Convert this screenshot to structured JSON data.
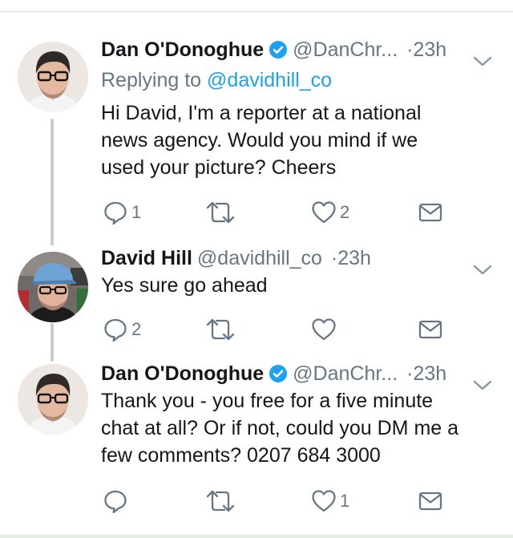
{
  "tweets": [
    {
      "author_name": "Dan O'Donoghue",
      "handle": "@DanChr...",
      "separator": "·",
      "time": "23h",
      "replying_prefix": "Replying to",
      "replying_to": "@davidhill_co",
      "text_lines": [
        "Hi David, I'm a reporter at a national",
        "news agency. Would you mind if we",
        "used your picture? Cheers"
      ],
      "replies": "1",
      "retweets": "",
      "likes": "2"
    },
    {
      "author_name": "David Hill",
      "handle": "@davidhill_co",
      "separator": "·",
      "time": "23h",
      "text_lines": [
        "Yes sure go ahead"
      ],
      "replies": "2",
      "retweets": "",
      "likes": ""
    },
    {
      "author_name": "Dan O'Donoghue",
      "handle": "@DanChr...",
      "separator": "·",
      "time": "23h",
      "text_lines": [
        "Thank you - you free for a five minute",
        "chat at all? Or if not, could you DM me a",
        "few comments? 0207 684 3000"
      ],
      "replies": "",
      "retweets": "",
      "likes": "1"
    }
  ],
  "colors": {
    "text": "#14171a",
    "secondary": "#657786",
    "link": "#1da1f2",
    "verified": "#1da1f2",
    "thread_line": "#c6cdd3"
  }
}
